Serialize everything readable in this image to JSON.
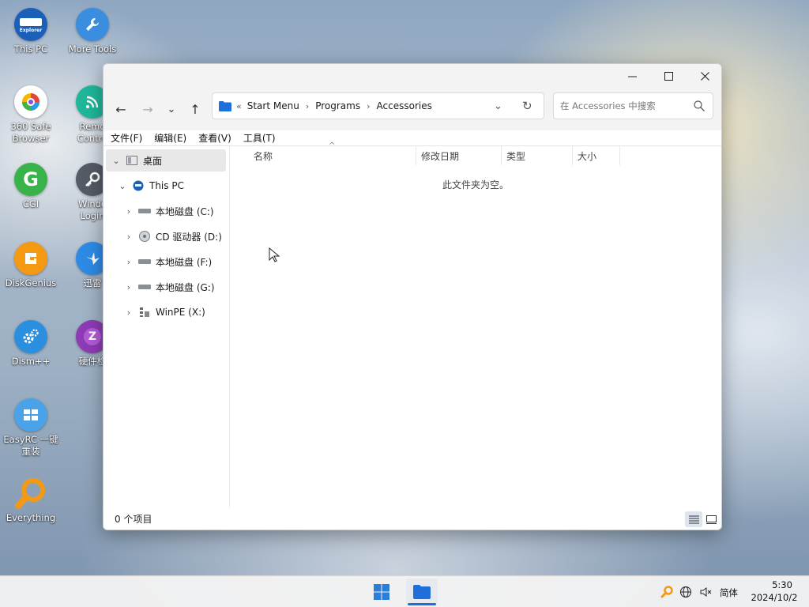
{
  "desktop": {
    "icons": [
      {
        "label": "This PC",
        "badge": "Explorer",
        "color": "#1b5fb8"
      },
      {
        "label": "More Tools",
        "color": "#3b8de0"
      },
      {
        "label": "360 Safe\nBrowser",
        "color": "#ffffff"
      },
      {
        "label": "Remo\nContro",
        "color": "#1fb79a"
      },
      {
        "label": "CGI",
        "badge": "G",
        "color": "#37b34a"
      },
      {
        "label": "Windo\nLogin",
        "color": "#555b66"
      },
      {
        "label": "DiskGenius",
        "color": "#f39a12"
      },
      {
        "label": "迅雷",
        "color": "#2d8be6"
      },
      {
        "label": "Dism++",
        "color": "#2b8fe0"
      },
      {
        "label": "硬件检",
        "badge": "Z",
        "color": "#8e3bb5"
      },
      {
        "label": "EasyRC 一键\n重装",
        "color": "#4aa3e8"
      },
      {
        "label": "Everything",
        "color": "#f39a12"
      }
    ]
  },
  "window": {
    "controls": {
      "minimize": "—",
      "maximize": "☐",
      "close": "✕"
    },
    "nav": {
      "back": "←",
      "forward": "→",
      "recent": "⌄",
      "up": "↑"
    },
    "address": {
      "overflow": "«",
      "crumbs": [
        "Start Menu",
        "Programs",
        "Accessories"
      ],
      "dropdown": "⌄",
      "refresh": "↻"
    },
    "search": {
      "placeholder": "在 Accessories 中搜索"
    },
    "menu": [
      "文件(F)",
      "编辑(E)",
      "查看(V)",
      "工具(T)"
    ],
    "tree": [
      {
        "label": "桌面",
        "chevron": "⌄"
      },
      {
        "label": "This PC",
        "chevron": "⌄"
      },
      {
        "label": "本地磁盘 (C:)",
        "chevron": "›"
      },
      {
        "label": "CD 驱动器 (D:)",
        "chevron": "›"
      },
      {
        "label": "本地磁盘 (F:)",
        "chevron": "›"
      },
      {
        "label": "本地磁盘 (G:)",
        "chevron": "›"
      },
      {
        "label": "WinPE (X:)",
        "chevron": "›"
      }
    ],
    "columns": [
      "名称",
      "修改日期",
      "类型",
      "大小"
    ],
    "sort_indicator": "^",
    "empty_message": "此文件夹为空。",
    "status": "0 个项目"
  },
  "taskbar": {
    "ime": "简体",
    "time": "5:30",
    "date": "2024/10/2"
  }
}
